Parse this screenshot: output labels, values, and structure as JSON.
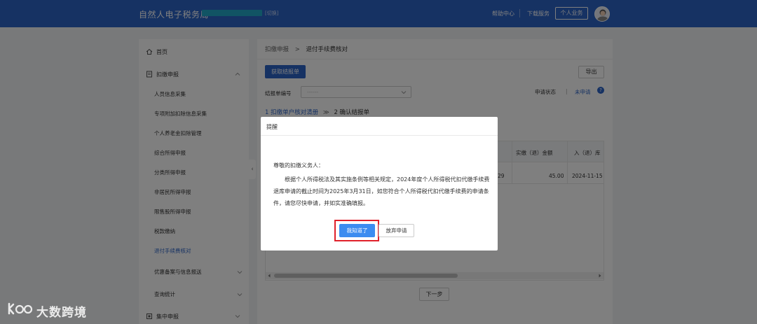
{
  "header": {
    "app_title": "自然人电子税务局",
    "switch_link": "[切换]",
    "help": "帮助中心",
    "separator": "|",
    "download": "下载服务",
    "personal_business": "个人业务"
  },
  "sidebar": {
    "home": "首页",
    "withholding": "扣缴申报",
    "sub_items": [
      "人员信息采集",
      "专项附加扣除信息采集",
      "个人养老金扣除管理",
      "综合所得申报",
      "分类所得申报",
      "非居民所得申报",
      "限售股所得申报",
      "税款缴纳",
      "退付手续费核对",
      "优惠备案与信息报送",
      "查询统计"
    ],
    "centralized": "集中申报",
    "collapse_glyph": "‹"
  },
  "main": {
    "breadcrumb_parent": "扣缴申报",
    "breadcrumb_sep": ">",
    "breadcrumb_current": "退付手续费核对",
    "fetch_button": "获取结报单",
    "export_button": "导出",
    "filter_label": "结报单编号",
    "filter_placeholder": "------",
    "status_label": "申请状态",
    "status_sep": "|",
    "status_value": "未申请",
    "status_help": "?",
    "step1": "1 扣缴单户核对清册",
    "step_arrow": "≫",
    "step2": "2 确认结报单",
    "table": {
      "headers": [
        "实缴（退）金额",
        "入（退）库"
      ],
      "row": {
        "partial": "29",
        "amount": "45.00",
        "date": "2024-11-15"
      }
    },
    "next_button": "下一步"
  },
  "modal": {
    "title": "提醒",
    "greeting": "尊敬的扣缴义务人：",
    "body": "根据个人所得税法及其实施条例等相关规定，2024年度个人所得税代扣代缴手续费退库申请的截止时间为2025年3月31日，如您符合个人所得税代扣代缴手续费的申请条件，请您尽快申请，并如实准确填报。",
    "acknowledge_button": "我知道了",
    "abandon_button": "放弃申请"
  },
  "watermark": {
    "text": "大数跨境"
  },
  "colors": {
    "header_bg": "#2d64c6",
    "primary": "#2d64c6",
    "modal_primary": "#3c8cf0",
    "highlight": "#e0202a"
  }
}
